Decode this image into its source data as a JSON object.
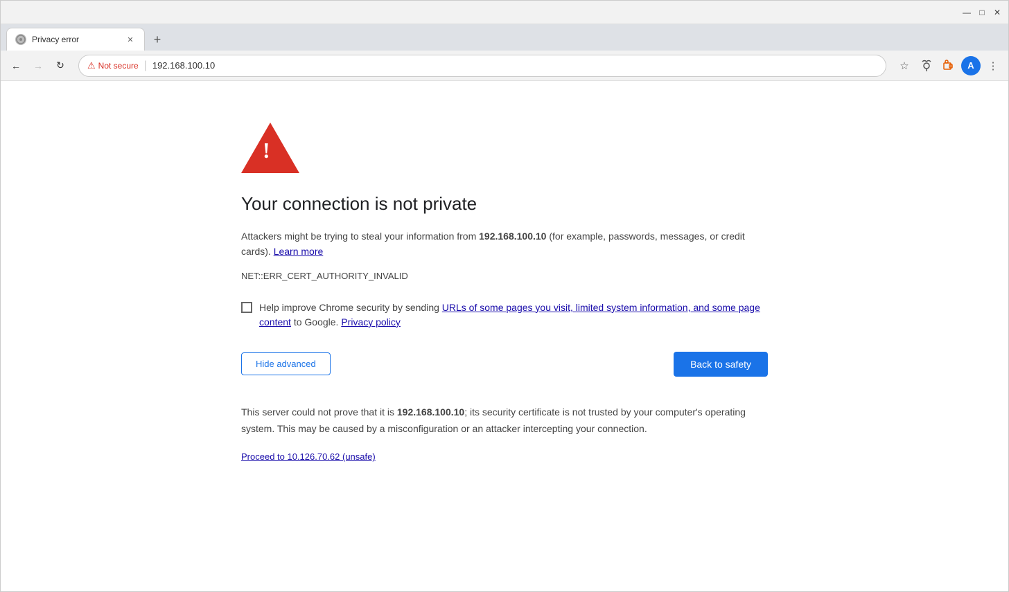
{
  "window": {
    "title": "Privacy error",
    "controls": {
      "minimize": "—",
      "maximize": "□",
      "close": "✕"
    }
  },
  "tab": {
    "favicon": "●",
    "title": "Privacy error",
    "close": "✕"
  },
  "new_tab_button": "+",
  "nav": {
    "back_arrow": "←",
    "forward_arrow": "→",
    "reload": "↻",
    "security_label": "Not secure",
    "url": "192.168.100.10",
    "star": "☆",
    "menu_dots": "⋮"
  },
  "error": {
    "heading": "Your connection is not private",
    "description_before": "Attackers might be trying to steal your information from ",
    "ip_bold": "192.168.100.10",
    "description_after": " (for example, passwords, messages, or credit cards).",
    "learn_more": "Learn more",
    "error_code": "NET::ERR_CERT_AUTHORITY_INVALID",
    "checkbox_text_before": "Help improve Chrome security by sending ",
    "checkbox_link": "URLs of some pages you visit, limited system information, and some page content",
    "checkbox_text_after": " to Google.",
    "privacy_policy": "Privacy policy",
    "btn_hide_advanced": "Hide advanced",
    "btn_back_to_safety": "Back to safety",
    "server_description_before": "This server could not prove that it is ",
    "server_ip_bold": "192.168.100.10",
    "server_description_after": "; its security certificate is not trusted by your computer's operating system. This may be caused by a misconfiguration or an attacker intercepting your connection.",
    "proceed_link": "Proceed to 10.126.70.62 (unsafe)"
  },
  "toolbar": {
    "spy_icon": "👁",
    "extension_icon": "🔧",
    "avatar_letter": "A"
  }
}
